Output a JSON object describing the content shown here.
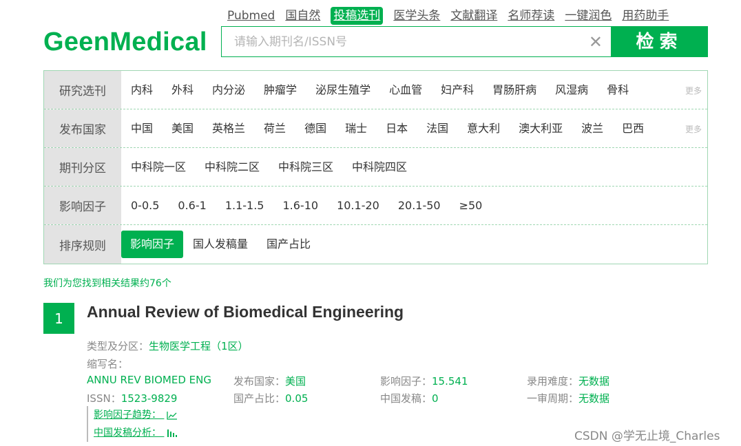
{
  "nav": {
    "items": [
      {
        "label": "Pubmed",
        "active": false
      },
      {
        "label": "国自然",
        "active": false
      },
      {
        "label": "投稿选刊",
        "active": true
      },
      {
        "label": "医学头条",
        "active": false
      },
      {
        "label": "文献翻译",
        "active": false
      },
      {
        "label": "名师荐读",
        "active": false
      },
      {
        "label": "一键润色",
        "active": false
      },
      {
        "label": "用药助手",
        "active": false
      }
    ]
  },
  "logo": "GeenMedical",
  "search": {
    "placeholder": "请输入期刊名/ISSN号",
    "value": "",
    "clear_icon": "close-icon",
    "button_label": "检索"
  },
  "filters": [
    {
      "label": "研究选刊",
      "options": [
        "内科",
        "外科",
        "内分泌",
        "肿瘤学",
        "泌尿生殖学",
        "心血管",
        "妇产科",
        "胃肠肝病",
        "风湿病",
        "骨科"
      ],
      "selected": null,
      "more": "更多"
    },
    {
      "label": "发布国家",
      "options": [
        "中国",
        "美国",
        "英格兰",
        "荷兰",
        "德国",
        "瑞士",
        "日本",
        "法国",
        "意大利",
        "澳大利亚",
        "波兰",
        "巴西"
      ],
      "selected": null,
      "more": "更多"
    },
    {
      "label": "期刊分区",
      "options": [
        "中科院一区",
        "中科院二区",
        "中科院三区",
        "中科院四区"
      ],
      "selected": null,
      "more": ""
    },
    {
      "label": "影响因子",
      "options": [
        "0-0.5",
        "0.6-1",
        "1.1-1.5",
        "1.6-10",
        "10.1-20",
        "20.1-50",
        "≥50"
      ],
      "selected": null,
      "more": ""
    },
    {
      "label": "排序规则",
      "options": [
        "影响因子",
        "国人发稿量",
        "国产占比"
      ],
      "selected": 0,
      "more": ""
    }
  ],
  "results": {
    "count_text": "我们为您找到相关结果约76个",
    "items": [
      {
        "index": "1",
        "title": "Annual Review of Biomedical Engineering",
        "type_label": "类型及分区：",
        "type_value": "生物医学工程（1区）",
        "abbr_label": "缩写名：",
        "abbr_value": "ANNU REV BIOMED ENG",
        "issn_label": "ISSN：",
        "issn_value": "1523-9829",
        "country_label": "发布国家：",
        "country_value": "美国",
        "domestic_ratio_label": "国产占比：",
        "domestic_ratio_value": "0.05",
        "if_label": "影响因子：",
        "if_value": "15.541",
        "china_pub_label": "中国发稿：",
        "china_pub_value": "0",
        "difficulty_label": "录用难度：",
        "difficulty_value": "无数据",
        "review_label": "一审周期：",
        "review_value": "无数据",
        "trend_if": "影响因子趋势：",
        "trend_china": "中国发稿分析："
      }
    ]
  },
  "watermark": "CSDN @学无止境_Charles",
  "colors": {
    "accent": "#00b050",
    "label_bg": "#e3e3e3",
    "border": "#9fd6b2"
  }
}
